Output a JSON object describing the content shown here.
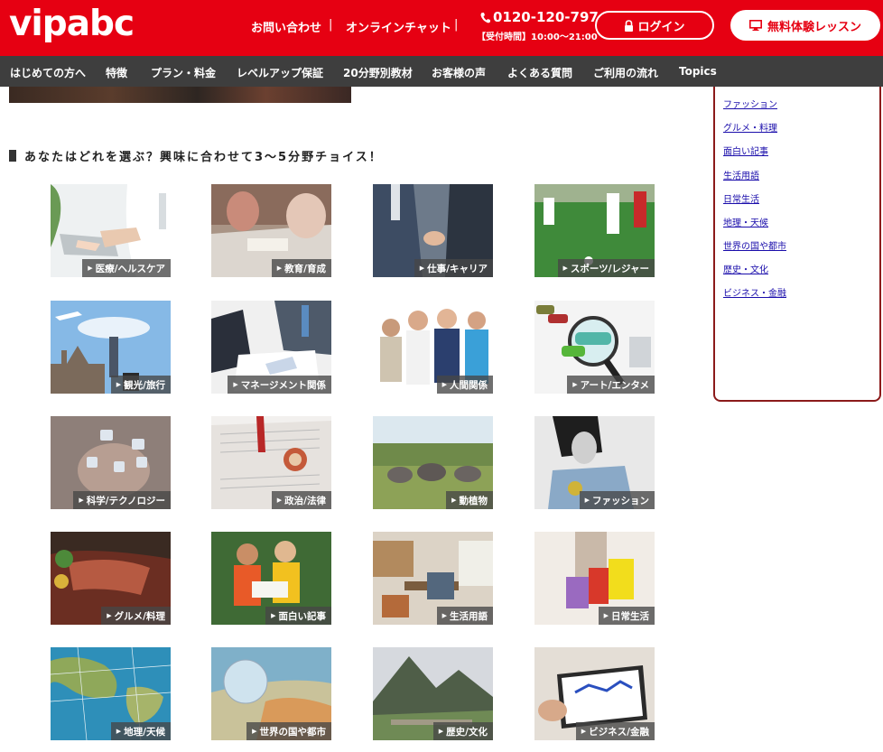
{
  "header": {
    "logo": "vipabc",
    "contact": "お問い合わせ",
    "chat": "オンラインチャット",
    "separator": "|",
    "phone": "0120-120-797",
    "hours": "【受付時間】10:00〜21:00",
    "login": "ログイン",
    "trial": "無料体験レッスン",
    "brand_color": "#e60012"
  },
  "nav": {
    "items": [
      "はじめての方へ",
      "特徴",
      "プラン・料金",
      "レベルアップ保証",
      "20分野別教材",
      "お客様の声",
      "よくある質問",
      "ご利用の流れ",
      "Topics"
    ]
  },
  "section": {
    "heading": "あなたはどれを選ぶ？興味に合わせて3〜5分野チョイス！"
  },
  "tiles": [
    {
      "label": "医療/ヘルスケア"
    },
    {
      "label": "教育/育成"
    },
    {
      "label": "仕事/キャリア"
    },
    {
      "label": "スポーツ/レジャー"
    },
    {
      "label": "観光/旅行"
    },
    {
      "label": "マネージメント関係"
    },
    {
      "label": "人間関係"
    },
    {
      "label": "アート/エンタメ"
    },
    {
      "label": "科学/テクノロジー"
    },
    {
      "label": "政治/法律"
    },
    {
      "label": "動植物"
    },
    {
      "label": "ファッション"
    },
    {
      "label": "グルメ/料理"
    },
    {
      "label": "面白い記事"
    },
    {
      "label": "生活用語"
    },
    {
      "label": "日常生活"
    },
    {
      "label": "地理/天候"
    },
    {
      "label": "世界の国や都市"
    },
    {
      "label": "歴史/文化"
    },
    {
      "label": "ビジネス/金融"
    }
  ],
  "sidebar": {
    "links": [
      "ファッション",
      "グルメ・料理",
      "面白い記事",
      "生活用語",
      "日常生活",
      "地理・天候",
      "世界の国や都市",
      "歴史・文化",
      "ビジネス・金融"
    ]
  }
}
